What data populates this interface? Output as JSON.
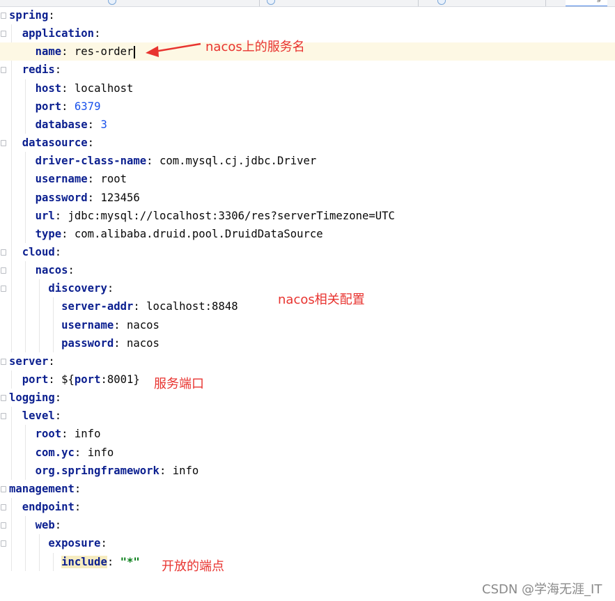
{
  "tab_strip": {
    "active_tab_suffix": "g"
  },
  "editor": {
    "lines": [
      {
        "key": "spring",
        "sep": ":",
        "val": "",
        "val_type": ""
      },
      {
        "key": "application",
        "sep": ":",
        "val": "",
        "val_type": ""
      },
      {
        "key": "name",
        "sep": ": ",
        "val": "res-order",
        "val_type": "plain"
      },
      {
        "key": "redis",
        "sep": ":",
        "val": "",
        "val_type": ""
      },
      {
        "key": "host",
        "sep": ": ",
        "val": "localhost",
        "val_type": "plain"
      },
      {
        "key": "port",
        "sep": ": ",
        "val": "6379",
        "val_type": "number"
      },
      {
        "key": "database",
        "sep": ": ",
        "val": "3",
        "val_type": "number"
      },
      {
        "key": "datasource",
        "sep": ":",
        "val": "",
        "val_type": ""
      },
      {
        "key": "driver-class-name",
        "sep": ": ",
        "val": "com.mysql.cj.jdbc.Driver",
        "val_type": "plain"
      },
      {
        "key": "username",
        "sep": ": ",
        "val": "root",
        "val_type": "plain"
      },
      {
        "key": "password",
        "sep": ": ",
        "val": "123456",
        "val_type": "plain"
      },
      {
        "key": "url",
        "sep": ": ",
        "val": "jdbc:mysql://localhost:3306/res?serverTimezone=UTC",
        "val_type": "plain"
      },
      {
        "key": "type",
        "sep": ": ",
        "val": "com.alibaba.druid.pool.DruidDataSource",
        "val_type": "plain"
      },
      {
        "key": "cloud",
        "sep": ":",
        "val": "",
        "val_type": ""
      },
      {
        "key": "nacos",
        "sep": ":",
        "val": "",
        "val_type": ""
      },
      {
        "key": "discovery",
        "sep": ":",
        "val": "",
        "val_type": ""
      },
      {
        "key": "server-addr",
        "sep": ": ",
        "val": "localhost:8848",
        "val_type": "plain"
      },
      {
        "key": "username",
        "sep": ": ",
        "val": "nacos",
        "val_type": "plain"
      },
      {
        "key": "password",
        "sep": ": ",
        "val": "nacos",
        "val_type": "plain"
      },
      {
        "key": "server",
        "sep": ":",
        "val": "",
        "val_type": ""
      },
      {
        "key": "port",
        "sep": ": ",
        "val": "8001",
        "val_type": "placeholder",
        "ph_open": "${",
        "ph_key": "port",
        "ph_sep": ":",
        "ph_close": "}"
      },
      {
        "key": "logging",
        "sep": ":",
        "val": "",
        "val_type": ""
      },
      {
        "key": "level",
        "sep": ":",
        "val": "",
        "val_type": ""
      },
      {
        "key": "root",
        "sep": ": ",
        "val": "info",
        "val_type": "plain"
      },
      {
        "key": "com.yc",
        "sep": ": ",
        "val": "info",
        "val_type": "plain"
      },
      {
        "key": "org.springframework",
        "sep": ": ",
        "val": "info",
        "val_type": "plain"
      },
      {
        "key": "management",
        "sep": ":",
        "val": "",
        "val_type": ""
      },
      {
        "key": "endpoint",
        "sep": ":",
        "val": "",
        "val_type": ""
      },
      {
        "key": "web",
        "sep": ":",
        "val": "",
        "val_type": ""
      },
      {
        "key": "exposure",
        "sep": ":",
        "val": "",
        "val_type": ""
      },
      {
        "key": "include",
        "sep": ": ",
        "val": "\"*\"",
        "val_type": "string"
      }
    ]
  },
  "annotations": {
    "service_name_note": "nacos上的服务名",
    "nacos_config_note": "nacos相关配置",
    "service_port_note": "服务端口",
    "open_endpoints_note": "开放的端点"
  },
  "watermark": "CSDN @学海无涯_IT",
  "colors": {
    "key": "#0b1f8f",
    "number": "#1750eb",
    "string": "#067d17",
    "annotation": "#e8332f",
    "current_line": "#fdf8e4"
  }
}
